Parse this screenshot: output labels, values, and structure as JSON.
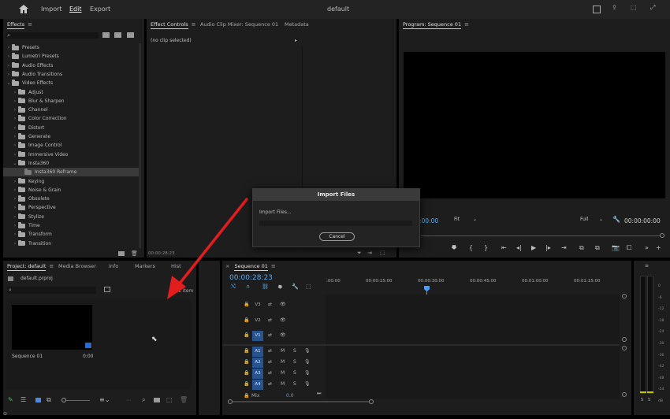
{
  "menubar": {
    "import": "Import",
    "edit": "Edit",
    "export": "Export",
    "title": "default"
  },
  "effects": {
    "tab": "Effects",
    "tree": [
      {
        "label": "Presets",
        "depth": 0,
        "open": false
      },
      {
        "label": "Lumetri Presets",
        "depth": 0,
        "open": false
      },
      {
        "label": "Audio Effects",
        "depth": 0,
        "open": false
      },
      {
        "label": "Audio Transitions",
        "depth": 0,
        "open": false
      },
      {
        "label": "Video Effects",
        "depth": 0,
        "open": true
      },
      {
        "label": "Adjust",
        "depth": 1,
        "open": false
      },
      {
        "label": "Blur & Sharpen",
        "depth": 1,
        "open": false
      },
      {
        "label": "Channel",
        "depth": 1,
        "open": false
      },
      {
        "label": "Color Correction",
        "depth": 1,
        "open": false
      },
      {
        "label": "Distort",
        "depth": 1,
        "open": false
      },
      {
        "label": "Generate",
        "depth": 1,
        "open": false
      },
      {
        "label": "Image Control",
        "depth": 1,
        "open": false
      },
      {
        "label": "Immersive Video",
        "depth": 1,
        "open": false
      },
      {
        "label": "Insta360",
        "depth": 1,
        "open": true
      },
      {
        "label": "Insta360 Reframe",
        "depth": 2,
        "open": false,
        "selected": true
      },
      {
        "label": "Keying",
        "depth": 1,
        "open": false
      },
      {
        "label": "Noise & Grain",
        "depth": 1,
        "open": false
      },
      {
        "label": "Obsolete",
        "depth": 1,
        "open": false
      },
      {
        "label": "Perspective",
        "depth": 1,
        "open": false
      },
      {
        "label": "Stylize",
        "depth": 1,
        "open": false
      },
      {
        "label": "Time",
        "depth": 1,
        "open": false
      },
      {
        "label": "Transform",
        "depth": 1,
        "open": false
      },
      {
        "label": "Transition",
        "depth": 1,
        "open": false
      }
    ]
  },
  "effect_controls": {
    "tab": "Effect Controls",
    "tab2": "Audio Clip Mixer: Sequence 01",
    "tab3": "Metadata",
    "no_clip": "(no clip selected)",
    "timecode": "00:00:28:23"
  },
  "program": {
    "tab": "Program: Sequence 01",
    "timecode": ":00:00",
    "fit": "Fit",
    "full": "Full",
    "duration": "00:00:00:00"
  },
  "dialog": {
    "title": "Import Files",
    "message": "Import Files...",
    "cancel": "Cancel"
  },
  "project": {
    "tab": "Project: default",
    "tab2": "Media Browser",
    "tab3": "Info",
    "tab4": "Markers",
    "tab5": "Hist",
    "filename": "default.prproj",
    "item_count": "1 item",
    "clip_name": "Sequence 01",
    "clip_duration": "0:00"
  },
  "timeline": {
    "tab": "Sequence 01",
    "timecode": "00:00:28:23",
    "ruler": [
      ":00:00",
      "00:00:15:00",
      "00:00:30:00",
      "00:00:45:00",
      "00:01:00:00",
      "00:01:15:00"
    ],
    "tracks": [
      "V3",
      "V2",
      "V1",
      "A1",
      "A2",
      "A3",
      "A4"
    ],
    "mute": "M",
    "solo": "S",
    "mix_label": "Mix",
    "mix_value": "0.0"
  },
  "meter": {
    "labels": [
      "0",
      "-6",
      "-12",
      "-18",
      "-24",
      "-30",
      "-36",
      "-42",
      "-48",
      "-54",
      "dB"
    ],
    "solo": "S"
  }
}
